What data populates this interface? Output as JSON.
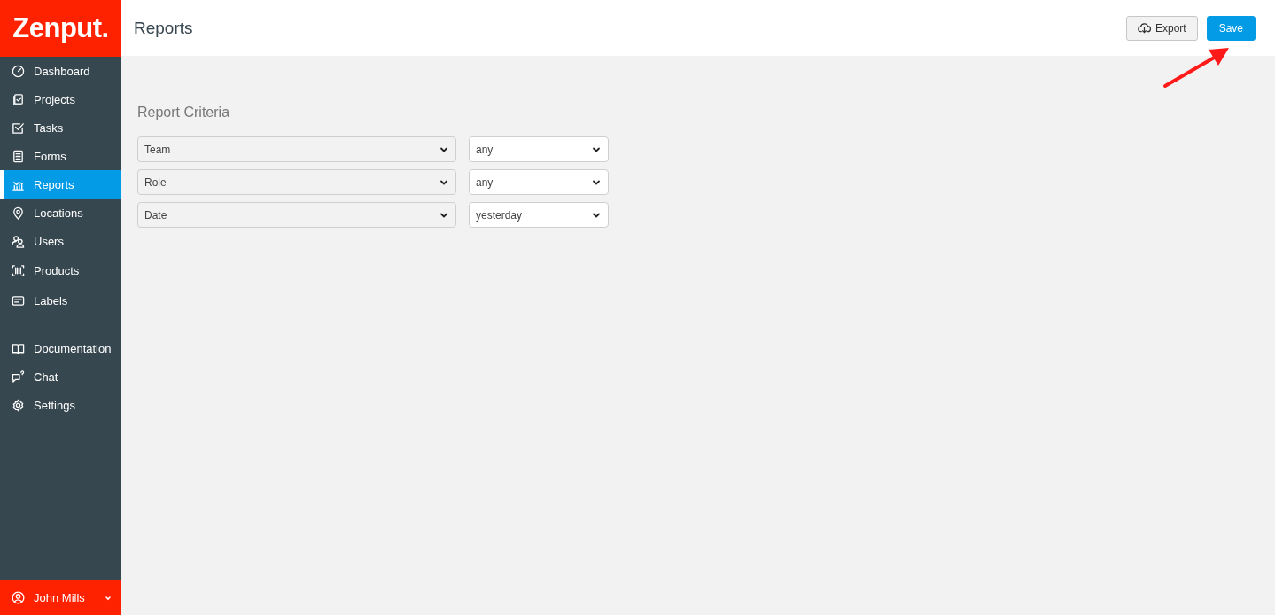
{
  "logo": {
    "text": "Zenput."
  },
  "sidebar": {
    "items": [
      {
        "label": "Dashboard",
        "selected": false
      },
      {
        "label": "Projects",
        "selected": false
      },
      {
        "label": "Tasks",
        "selected": false
      },
      {
        "label": "Forms",
        "selected": false
      },
      {
        "label": "Reports",
        "selected": true
      },
      {
        "label": "Locations",
        "selected": false
      },
      {
        "label": "Users",
        "selected": false
      },
      {
        "label": "Products",
        "selected": false
      },
      {
        "label": "Labels",
        "selected": false
      }
    ],
    "secondary_items": [
      {
        "label": "Documentation"
      },
      {
        "label": "Chat"
      },
      {
        "label": "Settings"
      }
    ],
    "user": {
      "name": "John Mills"
    }
  },
  "header": {
    "title": "Reports",
    "buttons": [
      {
        "label": "Export",
        "kind": "secondary"
      },
      {
        "label": "Save",
        "kind": "primary"
      }
    ]
  },
  "report_criteria": {
    "title": "Report Criteria",
    "rows": [
      {
        "field": "Team",
        "value": "any"
      },
      {
        "field": "Role",
        "value": "any"
      },
      {
        "field": "Date",
        "value": "yesterday"
      }
    ]
  }
}
